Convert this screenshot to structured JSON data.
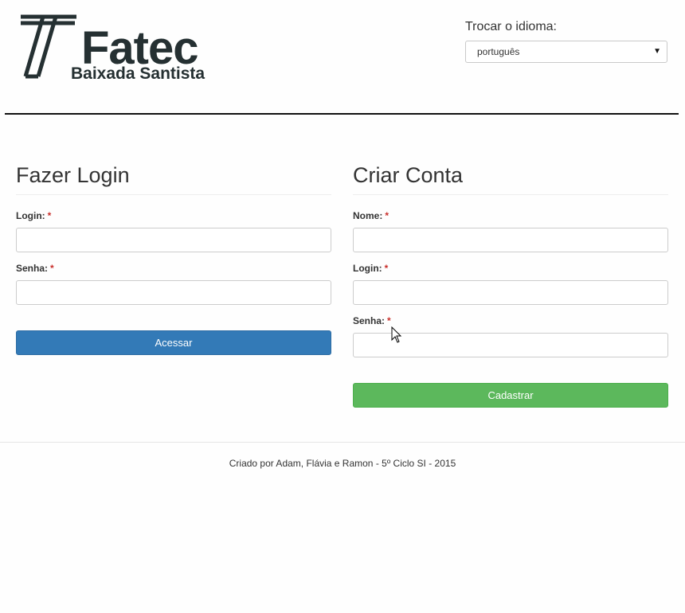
{
  "header": {
    "logo_brand": "Fatec",
    "logo_subtitle": "Baixada Santista",
    "language_label": "Trocar o idioma:",
    "language_selected": "português"
  },
  "login": {
    "title": "Fazer Login",
    "login_label": "Login:",
    "password_label": "Senha:",
    "required_mark": "*",
    "submit_label": "Acessar"
  },
  "register": {
    "title": "Criar Conta",
    "name_label": "Nome:",
    "login_label": "Login:",
    "password_label": "Senha:",
    "required_mark": "*",
    "submit_label": "Cadastrar"
  },
  "footer": {
    "text": "Criado por Adam, Flávia e Ramon - 5º Ciclo SI - 2015"
  },
  "colors": {
    "primary": "#337ab7",
    "success": "#5cb85c",
    "required": "#c9302c",
    "logo": "#253032"
  }
}
